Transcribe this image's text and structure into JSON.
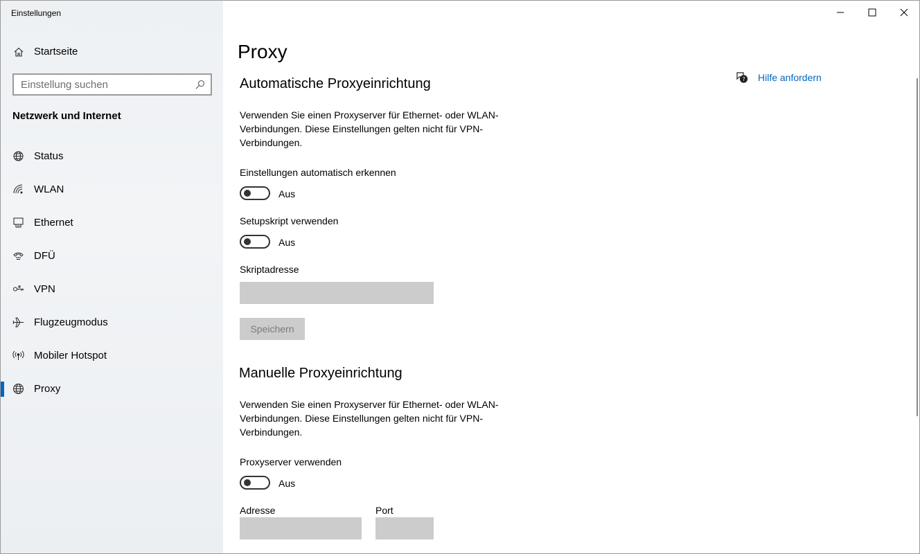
{
  "window": {
    "title": "Einstellungen"
  },
  "sidebar": {
    "home_label": "Startseite",
    "search_placeholder": "Einstellung suchen",
    "section_title": "Netzwerk und Internet",
    "items": [
      {
        "label": "Status",
        "icon": "status-globe-icon"
      },
      {
        "label": "WLAN",
        "icon": "wifi-icon"
      },
      {
        "label": "Ethernet",
        "icon": "ethernet-icon"
      },
      {
        "label": "DFÜ",
        "icon": "dialup-icon"
      },
      {
        "label": "VPN",
        "icon": "vpn-icon"
      },
      {
        "label": "Flugzeugmodus",
        "icon": "airplane-icon"
      },
      {
        "label": "Mobiler Hotspot",
        "icon": "hotspot-icon"
      },
      {
        "label": "Proxy",
        "icon": "globe-icon",
        "active": true
      }
    ]
  },
  "main": {
    "title": "Proxy",
    "help_label": "Hilfe anfordern",
    "auto": {
      "heading": "Automatische Proxyeinrichtung",
      "description": "Verwenden Sie einen Proxyserver für Ethernet- oder WLAN-Verbindungen. Diese Einstellungen gelten nicht für VPN-Verbindungen.",
      "detect_label": "Einstellungen automatisch erkennen",
      "detect_state": "Aus",
      "script_label": "Setupskript verwenden",
      "script_state": "Aus",
      "address_label": "Skriptadresse",
      "address_value": "",
      "save_label": "Speichern"
    },
    "manual": {
      "heading": "Manuelle Proxyeinrichtung",
      "description": "Verwenden Sie einen Proxyserver für Ethernet- oder WLAN-Verbindungen. Diese Einstellungen gelten nicht für VPN-Verbindungen.",
      "proxy_label": "Proxyserver verwenden",
      "proxy_state": "Aus",
      "address_label": "Adresse",
      "address_value": "",
      "port_label": "Port",
      "port_value": ""
    }
  },
  "colors": {
    "accent": "#0067c0",
    "disabled_fill": "#cccccc"
  }
}
